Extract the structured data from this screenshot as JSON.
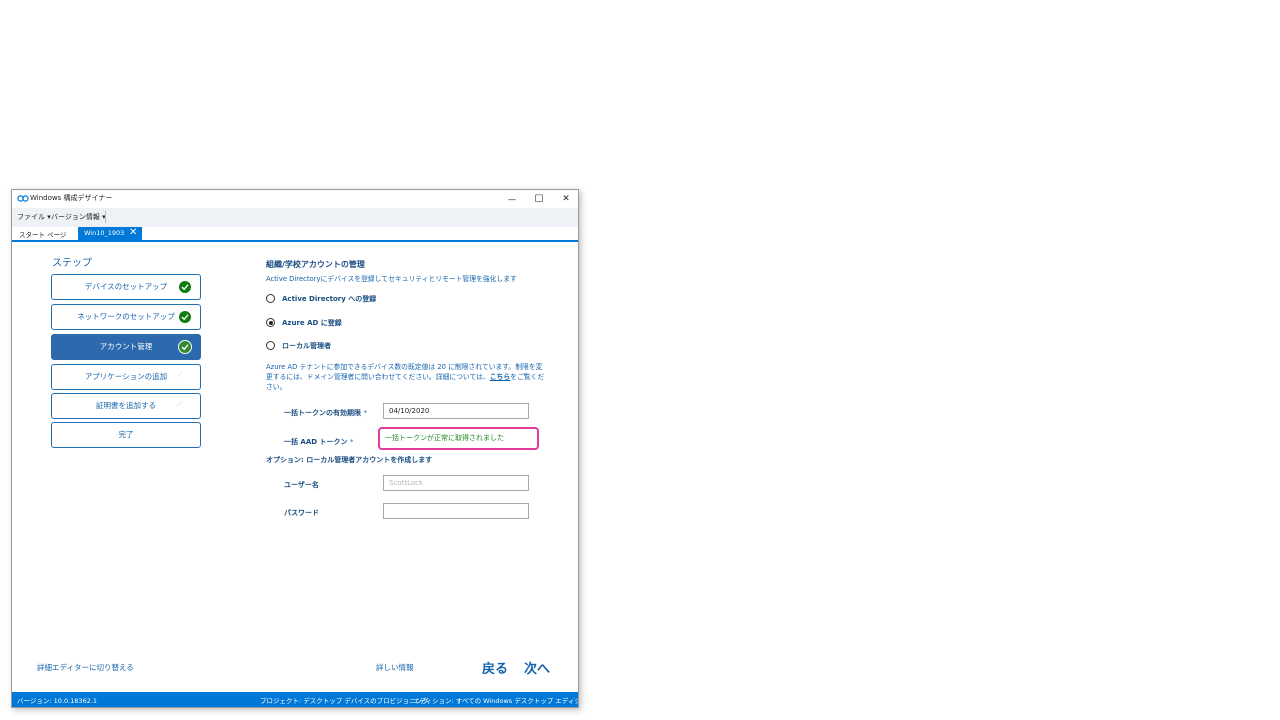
{
  "window": {
    "title": "Windows 構成デザイナー",
    "controls": {
      "minimize": "—",
      "maximize": "☐",
      "close": "✕"
    }
  },
  "menubar": {
    "items": [
      {
        "label": "ファイル ▾"
      },
      {
        "label": "バージョン情報 ▾"
      }
    ]
  },
  "tabs": {
    "start": "スタート ページ",
    "active": "Win10_1903",
    "close_glyph": "✕"
  },
  "steps": {
    "title": "ステップ",
    "items": [
      {
        "label": "デバイスのセットアップ",
        "status": "done"
      },
      {
        "label": "ネットワークのセットアップ",
        "status": "done"
      },
      {
        "label": "アカウント管理",
        "status": "done"
      },
      {
        "label": "アプリケーションの追加",
        "status": "pending"
      },
      {
        "label": "証明書を追加する",
        "status": "pending"
      },
      {
        "label": "完了",
        "status": "none"
      }
    ],
    "pending_glyph": "⟋"
  },
  "main": {
    "title": "組織/学校アカウントの管理",
    "subtitle": "Active Directoryにデバイスを登録してセキュリティとリモート管理を強化します",
    "radios": [
      {
        "label": "Active Directory への登録",
        "selected": false
      },
      {
        "label": "Azure AD に登録",
        "selected": true
      },
      {
        "label": "ローカル管理者",
        "selected": false
      }
    ],
    "info_text": "Azure AD テナントに参加できるデバイス数の既定値は 20 に制限されています。制限を変更するには、ドメイン管理者に問い合わせてください。詳細については、",
    "info_link": "こちら",
    "info_text_end": "をご覧ください。",
    "token_expiry_label": "一括トークンの有効期限",
    "token_expiry_value": "04/10/2020",
    "aad_token_label": "一括 AAD トークン",
    "aad_token_status": "一括トークンが正常に取得されました",
    "required_mark": "*",
    "optional_title": "オプション: ローカル管理者アカウントを作成します",
    "username_label": "ユーザー名",
    "username_placeholder": "ScottLock",
    "password_label": "パスワード",
    "password_value": ""
  },
  "bottom": {
    "switch_editor": "詳細エディターに切り替える",
    "more_info": "詳しい情報",
    "back": "戻る",
    "next": "次へ"
  },
  "status": {
    "version": "バージョン: 10.0.18362.1",
    "project": "プロジェクト: デスクトップ デバイスのプロビジョニング",
    "edition": "エディション: すべての Windows デスクトップ エディション"
  },
  "colors": {
    "accent": "#0078d7",
    "step_active": "#2d6aad",
    "check_green": "#107c10",
    "highlight_pink": "#e23a9d",
    "success_text": "#1d8a1d"
  }
}
